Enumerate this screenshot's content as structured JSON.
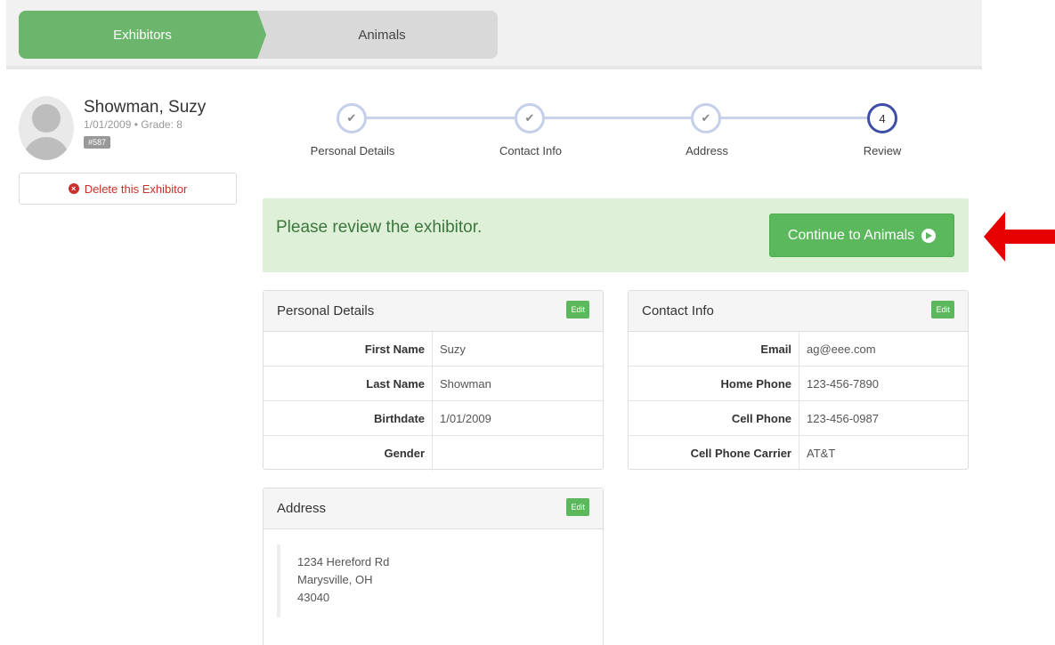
{
  "tabs": [
    {
      "label": "Exhibitors",
      "active": true
    },
    {
      "label": "Animals",
      "active": false
    }
  ],
  "exhibitor": {
    "name": "Showman, Suzy",
    "meta": "1/01/2009 • Grade: 8",
    "badge": "#587",
    "delete_label": "Delete this Exhibitor"
  },
  "steps": [
    {
      "label": "Personal Details",
      "status": "done",
      "marker": "✔"
    },
    {
      "label": "Contact Info",
      "status": "done",
      "marker": "✔"
    },
    {
      "label": "Address",
      "status": "done",
      "marker": "✔"
    },
    {
      "label": "Review",
      "status": "active",
      "marker": "4"
    }
  ],
  "alert": {
    "text": "Please review the exhibitor.",
    "continue_label": "Continue to Animals"
  },
  "personal": {
    "title": "Personal Details",
    "edit_label": "Edit",
    "rows": [
      {
        "label": "First Name",
        "value": "Suzy"
      },
      {
        "label": "Last Name",
        "value": "Showman"
      },
      {
        "label": "Birthdate",
        "value": "1/01/2009"
      },
      {
        "label": "Gender",
        "value": ""
      }
    ]
  },
  "contact": {
    "title": "Contact Info",
    "edit_label": "Edit",
    "rows": [
      {
        "label": "Email",
        "value": "ag@eee.com"
      },
      {
        "label": "Home Phone",
        "value": "123-456-7890"
      },
      {
        "label": "Cell Phone",
        "value": "123-456-0987"
      },
      {
        "label": "Cell Phone Carrier",
        "value": "AT&T"
      }
    ]
  },
  "address": {
    "title": "Address",
    "edit_label": "Edit",
    "line1": "1234 Hereford Rd",
    "line2": "Marysville, OH",
    "line3": "43040"
  },
  "colors": {
    "accent_green": "#5cb85c",
    "step_active": "#3f4fa6",
    "pointer_red": "#e60000"
  }
}
